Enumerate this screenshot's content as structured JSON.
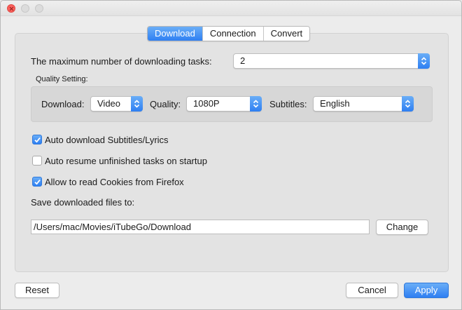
{
  "tabs": [
    {
      "label": "Download",
      "active": true
    },
    {
      "label": "Connection",
      "active": false
    },
    {
      "label": "Convert",
      "active": false
    }
  ],
  "download": {
    "max_tasks_label": "The maximum number of downloading tasks:",
    "max_tasks_value": "2",
    "quality_setting_label": "Quality Setting:",
    "download_label": "Download:",
    "download_value": "Video",
    "quality_label": "Quality:",
    "quality_value": "1080P",
    "subtitles_label": "Subtitles:",
    "subtitles_value": "English",
    "options": [
      {
        "label": "Auto download Subtitles/Lyrics",
        "checked": true
      },
      {
        "label": "Auto resume unfinished tasks on startup",
        "checked": false
      },
      {
        "label": "Allow to read Cookies from Firefox",
        "checked": true
      }
    ],
    "save_to_label": "Save downloaded files to:",
    "save_path": "/Users/mac/Movies/iTubeGo/Download",
    "change_label": "Change"
  },
  "footer": {
    "reset_label": "Reset",
    "cancel_label": "Cancel",
    "apply_label": "Apply"
  },
  "colors": {
    "accent": "#2e7ff2",
    "close_button": "#fc605c"
  },
  "icons": [
    "popup-arrows-icon",
    "checkmark-icon"
  ]
}
